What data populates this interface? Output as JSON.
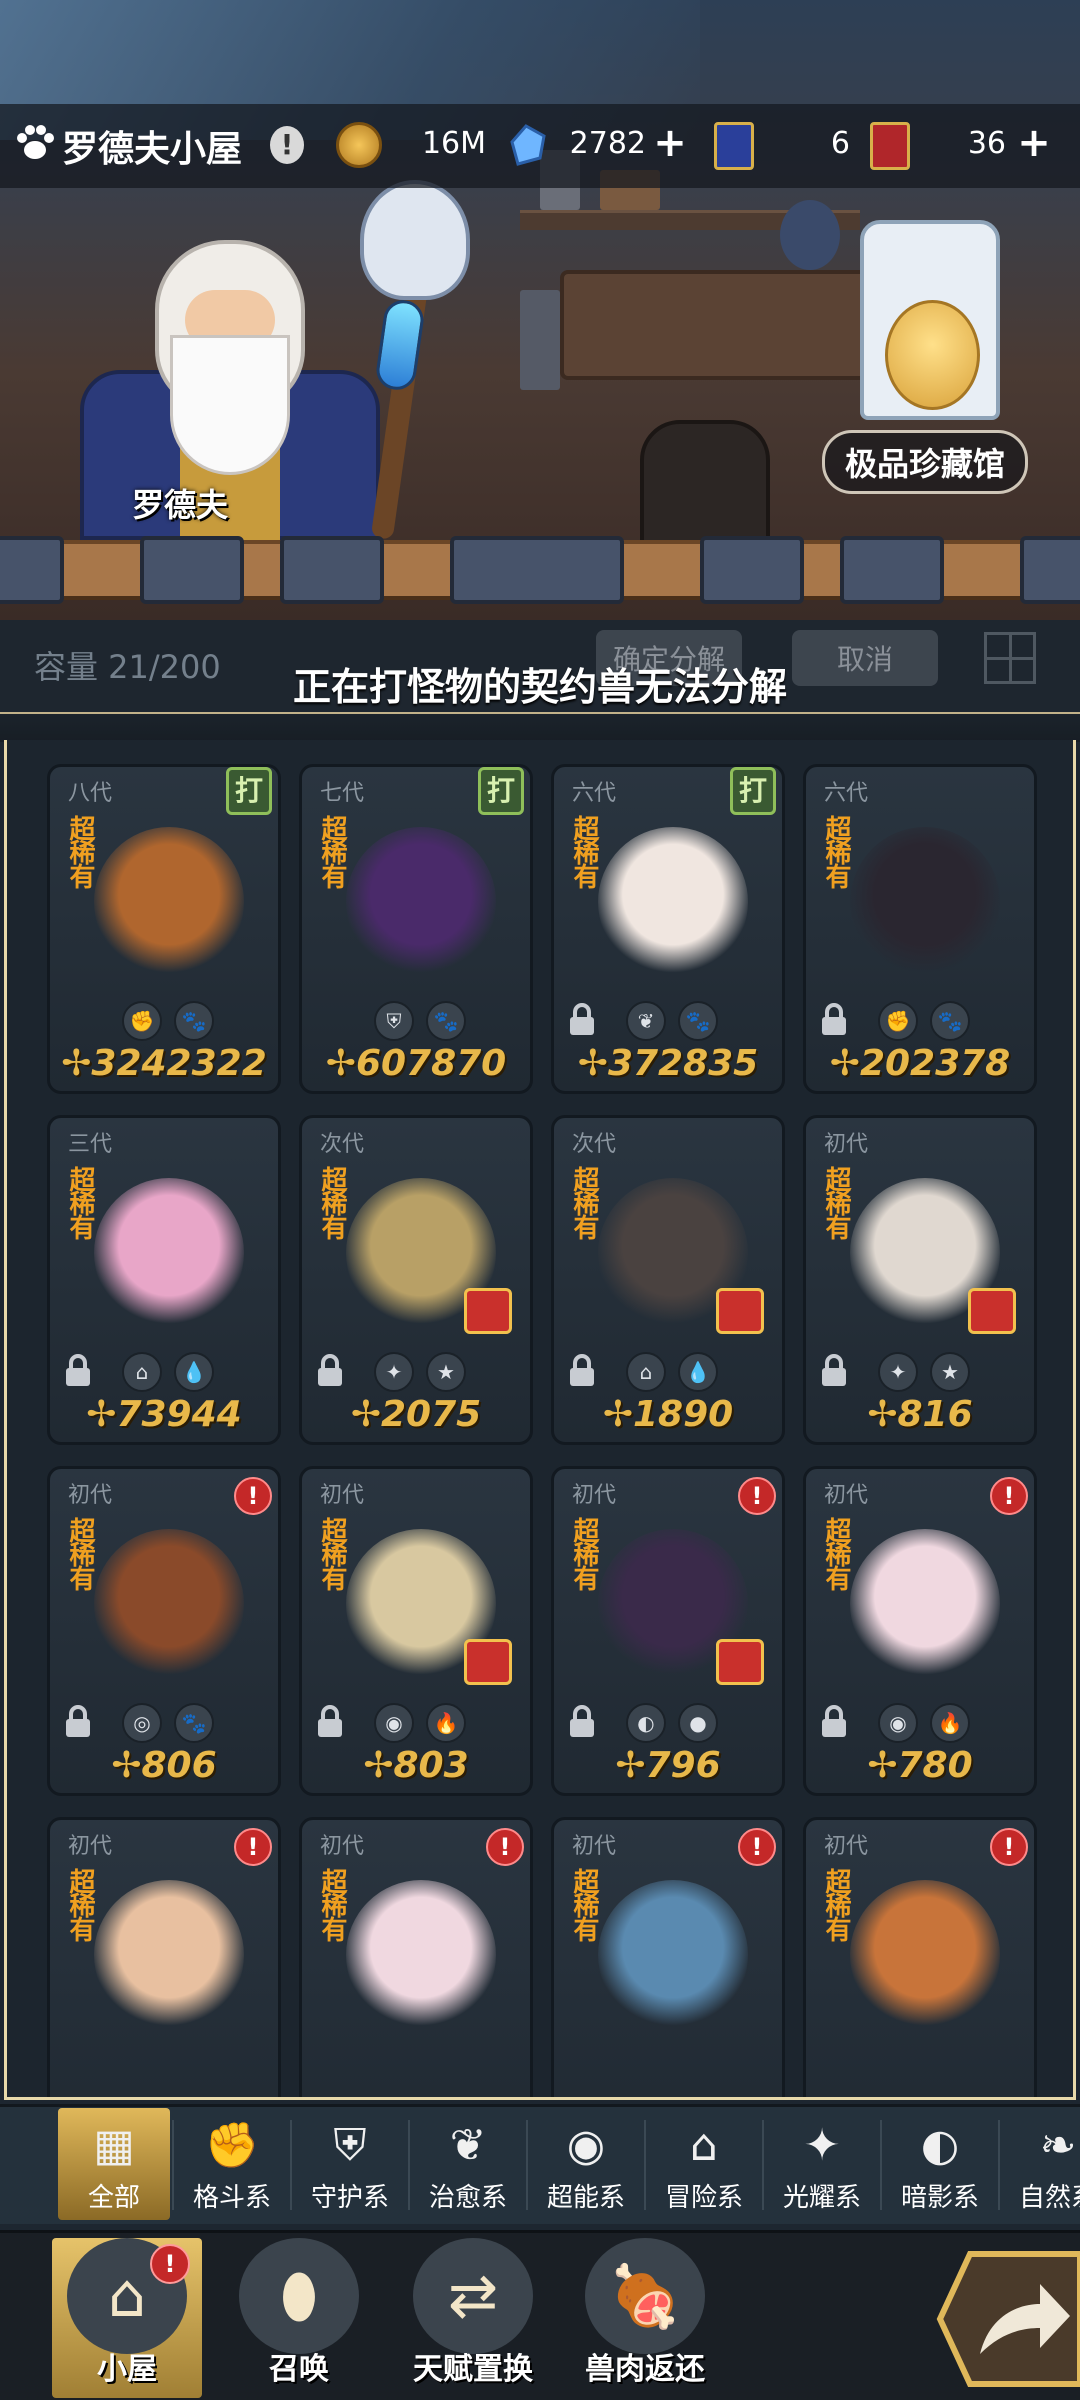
{
  "header": {
    "title": "罗德夫小屋",
    "alert": "!",
    "resources": [
      {
        "icon": "gold-coin-icon",
        "value": "16M",
        "has_plus": false
      },
      {
        "icon": "crystal-icon",
        "value": "2782",
        "has_plus": true
      },
      {
        "icon": "blue-ticket-icon",
        "value": "6",
        "has_plus": false
      },
      {
        "icon": "red-ticket-icon",
        "value": "36",
        "has_plus": true
      }
    ]
  },
  "scene": {
    "npc_name": "罗德夫",
    "museum_label": "极品珍藏馆"
  },
  "controls": {
    "capacity": "容量 21/200",
    "confirm_label": "确定分解",
    "cancel_label": "取消",
    "toast": "正在打怪物的契约兽无法分解"
  },
  "cards": [
    {
      "gen": "八代",
      "rarity": "超稀有",
      "power": "3242322",
      "badge": "fight",
      "badge_text": "打",
      "locked": false,
      "types": [
        "fist-icon",
        "paw-icon"
      ],
      "color": "#b0662e",
      "gold_tag": false
    },
    {
      "gen": "七代",
      "rarity": "超稀有",
      "power": "607870",
      "badge": "fight",
      "badge_text": "打",
      "locked": false,
      "types": [
        "shield-icon",
        "paw-icon"
      ],
      "color": "#4a2a6a",
      "gold_tag": false
    },
    {
      "gen": "六代",
      "rarity": "超稀有",
      "power": "372835",
      "badge": "fight",
      "badge_text": "打",
      "locked": true,
      "types": [
        "sprout-icon",
        "paw-icon"
      ],
      "color": "#f0e6e0",
      "gold_tag": false
    },
    {
      "gen": "六代",
      "rarity": "超稀有",
      "power": "202378",
      "badge": "none",
      "badge_text": "",
      "locked": true,
      "types": [
        "fist-icon",
        "paw-icon"
      ],
      "color": "#2a2630",
      "gold_tag": false
    },
    {
      "gen": "三代",
      "rarity": "超稀有",
      "power": "73944",
      "badge": "none",
      "badge_text": "",
      "locked": true,
      "types": [
        "adventure-icon",
        "water-drop-icon"
      ],
      "color": "#e8a6c8",
      "gold_tag": false
    },
    {
      "gen": "次代",
      "rarity": "超稀有",
      "power": "2075",
      "badge": "none",
      "badge_text": "",
      "locked": true,
      "types": [
        "light-icon",
        "star-icon"
      ],
      "color": "#b8a066",
      "gold_tag": true
    },
    {
      "gen": "次代",
      "rarity": "超稀有",
      "power": "1890",
      "badge": "none",
      "badge_text": "",
      "locked": true,
      "types": [
        "adventure-icon",
        "water-drop-icon"
      ],
      "color": "#4a4240",
      "gold_tag": true
    },
    {
      "gen": "初代",
      "rarity": "超稀有",
      "power": "816",
      "badge": "none",
      "badge_text": "",
      "locked": true,
      "types": [
        "light-icon",
        "star-icon"
      ],
      "color": "#e0d8d0",
      "gold_tag": true
    },
    {
      "gen": "初代",
      "rarity": "超稀有",
      "power": "806",
      "badge": "warn",
      "badge_text": "!",
      "locked": true,
      "types": [
        "rock-icon",
        "paw-icon"
      ],
      "color": "#8a4a2a",
      "gold_tag": false
    },
    {
      "gen": "初代",
      "rarity": "超稀有",
      "power": "803",
      "badge": "none",
      "badge_text": "",
      "locked": true,
      "types": [
        "psychic-icon",
        "fire-icon"
      ],
      "color": "#d8c8a0",
      "gold_tag": true
    },
    {
      "gen": "初代",
      "rarity": "超稀有",
      "power": "796",
      "badge": "warn",
      "badge_text": "!",
      "locked": true,
      "types": [
        "shadow-icon",
        "dark-orb-icon"
      ],
      "color": "#3a2a4a",
      "gold_tag": true
    },
    {
      "gen": "初代",
      "rarity": "超稀有",
      "power": "780",
      "badge": "warn",
      "badge_text": "!",
      "locked": true,
      "types": [
        "psychic-icon",
        "fire-icon"
      ],
      "color": "#f0d8e0",
      "gold_tag": false
    },
    {
      "gen": "初代",
      "rarity": "超稀有",
      "power": "",
      "badge": "warn",
      "badge_text": "!",
      "locked": false,
      "types": [],
      "color": "#e8c0a0",
      "gold_tag": false
    },
    {
      "gen": "初代",
      "rarity": "超稀有",
      "power": "",
      "badge": "warn",
      "badge_text": "!",
      "locked": false,
      "types": [],
      "color": "#f0d8e0",
      "gold_tag": false
    },
    {
      "gen": "初代",
      "rarity": "超稀有",
      "power": "",
      "badge": "warn",
      "badge_text": "!",
      "locked": false,
      "types": [],
      "color": "#5a8ab0",
      "gold_tag": false
    },
    {
      "gen": "初代",
      "rarity": "超稀有",
      "power": "",
      "badge": "warn",
      "badge_text": "!",
      "locked": false,
      "types": [],
      "color": "#c8743a",
      "gold_tag": false
    }
  ],
  "filters": [
    {
      "label": "全部",
      "icon": "all-blocks-icon",
      "active": true
    },
    {
      "label": "格斗系",
      "icon": "fist-icon",
      "active": false
    },
    {
      "label": "守护系",
      "icon": "shield-icon",
      "active": false
    },
    {
      "label": "治愈系",
      "icon": "sprout-icon",
      "active": false
    },
    {
      "label": "超能系",
      "icon": "psychic-icon",
      "active": false
    },
    {
      "label": "冒险系",
      "icon": "adventure-icon",
      "active": false
    },
    {
      "label": "光耀系",
      "icon": "light-icon",
      "active": false
    },
    {
      "label": "暗影系",
      "icon": "shadow-icon",
      "active": false
    },
    {
      "label": "自然系",
      "icon": "leaf-icon",
      "active": false
    }
  ],
  "nav": [
    {
      "label": "小屋",
      "icon": "house-icon",
      "active": true,
      "alert": "!"
    },
    {
      "label": "召唤",
      "icon": "egg-icon",
      "active": false
    },
    {
      "label": "天赋置换",
      "icon": "swap-icon",
      "active": false
    },
    {
      "label": "兽肉返还",
      "icon": "meat-icon",
      "active": false
    }
  ],
  "colors": {
    "accent_gold": "#e0b85a",
    "power_gold": "#e8b84a",
    "rarity_orange": "#f0a020",
    "alert_red": "#c42828",
    "panel_bg": "#1c252e"
  }
}
